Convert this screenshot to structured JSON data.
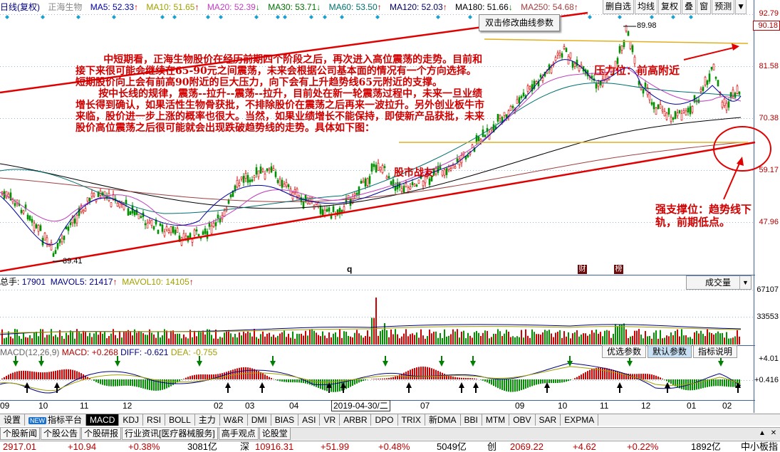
{
  "header": {
    "title": "日线(复权)",
    "stock_name": "正海生物",
    "ma": [
      {
        "label": "MA5: 52.33",
        "arrow": "↑",
        "color": "#0000a0"
      },
      {
        "label": "MA10: 51.65",
        "arrow": "↑",
        "color": "#a0a000"
      },
      {
        "label": "MA20: 52.39",
        "arrow": "↓",
        "color": "#c040c0"
      },
      {
        "label": "MA30: 53.71",
        "arrow": "↓",
        "color": "#007000"
      },
      {
        "label": "MA60: 53.50",
        "arrow": "↑",
        "color": "#007070"
      },
      {
        "label": "MA120: 52.03",
        "arrow": "↑",
        "color": "#000060"
      },
      {
        "label": "MA180: 51.66",
        "arrow": "↓",
        "color": "#000000"
      },
      {
        "label": "MA250: 54.68",
        "arrow": "↑",
        "color": "#a04040"
      }
    ]
  },
  "top_buttons": [
    "删自选",
    "均线",
    "复权",
    "叠",
    "窗",
    "预测",
    "▼"
  ],
  "tooltip": "双击修改曲线参数",
  "price_axis": [
    "92.79",
    "90.18",
    "81.58",
    "70.38",
    "59.17",
    "47.96"
  ],
  "price_marks": {
    "high": "89.98",
    "low": "39.41"
  },
  "annotation_main": [
    "中短期看，正海生物股价在经历前期四个阶段之后，再次进入高位震荡的走势。目前和接下来很可能会继续在65-90元之间震荡，未来会根据公司基本面的情况有一个方向选择。短期股价向上会有前高90附近的巨大压力，向下会有上升趋势线65元附近的支撑。",
    "按中长线的规律，震荡--拉升--震荡--拉升，目前处在新一轮震荡过程中，未来一旦业绩增长得到确认，如果活性生物骨获批，不排除股价在震荡之后再来一波拉升。另外创业板牛市来临，股价进一步上涨的概率也很大。当然，如果业绩增长不能保持，即使新产品获批，未来股价高位震荡之后很可能就会出现跌破趋势线的走势。具体如下图："
  ],
  "annotation_pressure": "压力位：前高附近",
  "annotation_support": "强支撑位：趋势线下轨，前期低点。",
  "annotation_watermark": "股市战友",
  "chart_markers": {
    "q": "q",
    "cai": "财",
    "jiang": "榜"
  },
  "volume": {
    "label": "总手:",
    "value": "17901",
    "mavol5": "MAVOL5: 21417",
    "mavol5_arrow": "↑",
    "mavol10": "MAVOL10: 14105",
    "mavol10_arrow": "↑",
    "select": "成交量",
    "axis": [
      "67107",
      "33553"
    ]
  },
  "macd": {
    "name": "MACD(12,26,9)",
    "macd": "MACD: +0.268",
    "diff": "DIFF: -0.621",
    "dea": "DEA: -0.755",
    "axis": [
      "+4.01",
      "+0.416"
    ],
    "tabs": [
      "优选参数",
      "默认参数",
      "指标说明"
    ]
  },
  "date_axis": {
    "labels": [
      "09",
      "10",
      "11",
      "12",
      "02",
      "03",
      "04",
      "07",
      "09",
      "10",
      "11",
      "12",
      "01",
      "02"
    ],
    "current": "2019-04-30/二"
  },
  "indicator_tabs": [
    "设置",
    "NEW",
    "指标平台",
    "MACD",
    "KDJ",
    "RSI",
    "BOLL",
    "主力",
    "W&R",
    "DMI",
    "BIAS",
    "ASI",
    "VR",
    "ARBR",
    "DPO",
    "TRIX",
    "新DMA",
    "BBI",
    "MTM",
    "OBV",
    "SAR",
    "EXPMA"
  ],
  "news_tabs": [
    "个股新闻",
    "个股公告",
    "个股研报",
    "行业资讯[医疗器械服务]",
    "高手观点",
    "论股堂"
  ],
  "status": [
    {
      "text": "2917.01",
      "cls": "red"
    },
    {
      "text": "+10.94",
      "cls": "red"
    },
    {
      "text": "+0.38%",
      "cls": "red"
    },
    {
      "text": "3081亿",
      "cls": "blk"
    },
    {
      "text": "深",
      "cls": "blk"
    },
    {
      "text": "10916.31",
      "cls": "red"
    },
    {
      "text": "+51.99",
      "cls": "red"
    },
    {
      "text": "+0.48%",
      "cls": "red"
    },
    {
      "text": "5049亿",
      "cls": "blk"
    },
    {
      "text": "创",
      "cls": "blk"
    },
    {
      "text": "2069.22",
      "cls": "red"
    },
    {
      "text": "+4.62",
      "cls": "red"
    },
    {
      "text": "+0.22%",
      "cls": "red"
    },
    {
      "text": "1892亿",
      "cls": "blk"
    },
    {
      "text": "中小板指",
      "cls": "blk"
    }
  ]
}
